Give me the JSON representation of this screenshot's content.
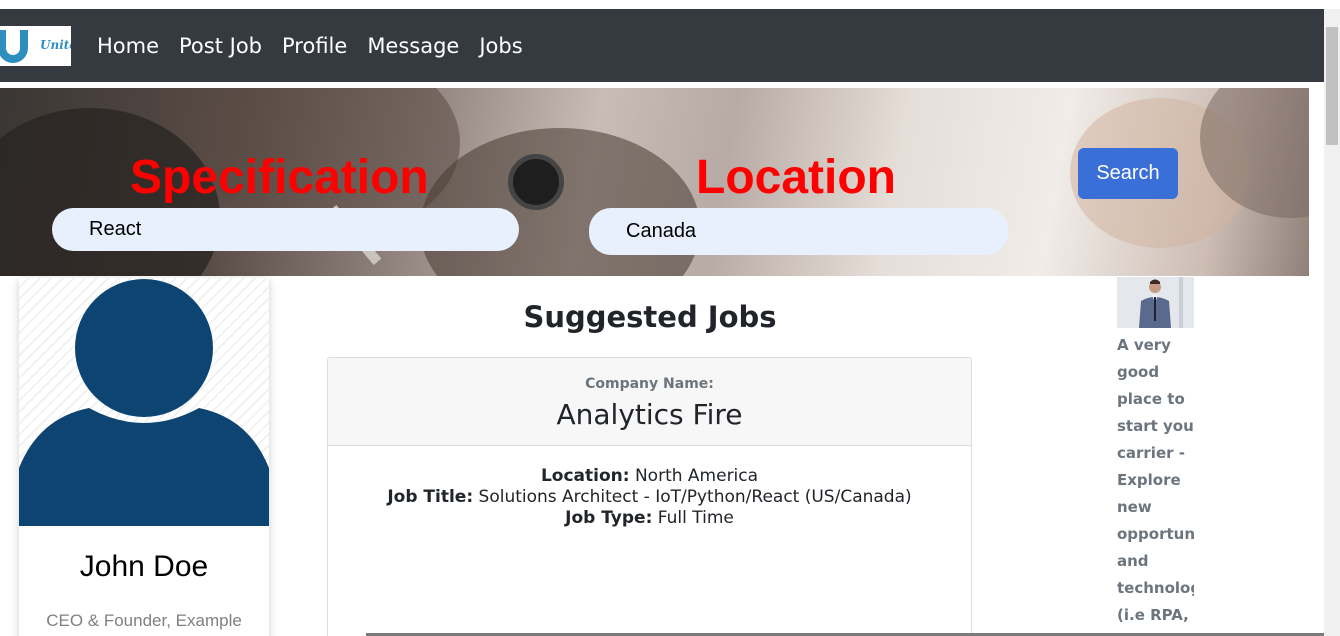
{
  "nav": {
    "logo_text": "Unite",
    "links": [
      "Home",
      "Post Job",
      "Profile",
      "Message",
      "Jobs"
    ]
  },
  "search": {
    "specification_label": "Specification",
    "location_label": "Location",
    "specification_value": "React",
    "location_value": "Canada",
    "search_label": "Search"
  },
  "profile": {
    "name": "John Doe",
    "title": "CEO & Founder, Example"
  },
  "jobs": {
    "section_title": "Suggested Jobs",
    "company_label": "Company Name:",
    "company_name": "Analytics Fire",
    "location_label": "Location:",
    "location_value": "North America",
    "job_title_label": "Job Title:",
    "job_title_value": "Solutions Architect - IoT/Python/React (US/Canada)",
    "job_type_label": "Job Type:",
    "job_type_value": "Full Time"
  },
  "sidebar_ad": {
    "lines": [
      "A very",
      "good",
      "place to",
      "start your",
      "carrier -",
      "Explore",
      "new",
      "opportuni",
      "and",
      "technologi",
      "(i.e RPA,"
    ]
  },
  "colors": {
    "navbar": "#343a40",
    "hero_heading": "#ff0000",
    "search_button": "#3b6fd8",
    "input_bg": "#e8f0fe",
    "avatar": "#0e4472"
  }
}
